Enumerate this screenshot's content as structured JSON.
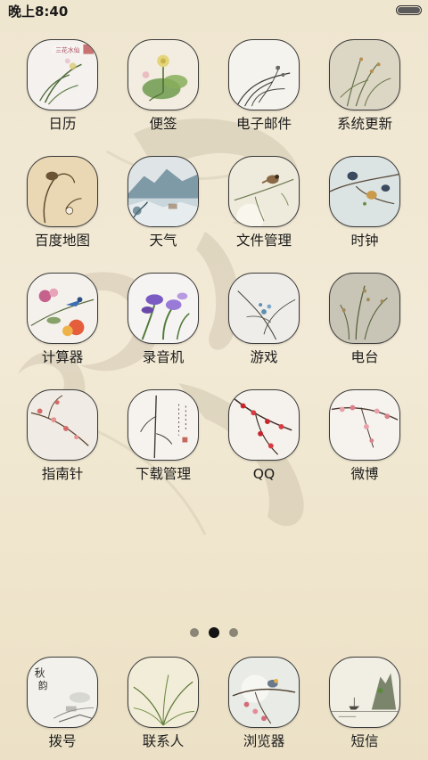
{
  "status_bar": {
    "time": "晚上8:40",
    "battery_level": 1.0
  },
  "page_indicator": {
    "page_count": 3,
    "active_page": 2
  },
  "apps": [
    [
      {
        "label": "日历",
        "icon": "orchid-calendar-icon"
      },
      {
        "label": "便签",
        "icon": "lotus-notes-icon"
      },
      {
        "label": "电子邮件",
        "icon": "orchid-email-icon"
      },
      {
        "label": "系统更新",
        "icon": "grass-update-icon"
      }
    ],
    [
      {
        "label": "百度地图",
        "icon": "lotus-pod-map-icon"
      },
      {
        "label": "天气",
        "icon": "landscape-weather-icon"
      },
      {
        "label": "文件管理",
        "icon": "sparrow-files-icon"
      },
      {
        "label": "时钟",
        "icon": "birds-clock-icon"
      }
    ],
    [
      {
        "label": "计算器",
        "icon": "bird-flower-calculator-icon"
      },
      {
        "label": "录音机",
        "icon": "iris-recorder-icon"
      },
      {
        "label": "游戏",
        "icon": "orchid-game-icon"
      },
      {
        "label": "电台",
        "icon": "grass-radio-icon"
      }
    ],
    [
      {
        "label": "指南针",
        "icon": "blossom-compass-icon"
      },
      {
        "label": "下载管理",
        "icon": "bamboo-download-icon"
      },
      {
        "label": "QQ",
        "icon": "plum-qq-icon"
      },
      {
        "label": "微博",
        "icon": "cherry-weibo-icon"
      }
    ]
  ],
  "dock": [
    {
      "label": "拨号",
      "icon": "calligraphy-phone-icon"
    },
    {
      "label": "联系人",
      "icon": "grass-contacts-icon"
    },
    {
      "label": "浏览器",
      "icon": "moon-bird-browser-icon"
    },
    {
      "label": "短信",
      "icon": "mountain-message-icon"
    }
  ],
  "colors": {
    "background": "#f0e7d1",
    "icon_border": "#3a3a3a",
    "label_text": "#1b1b1b",
    "dot_active": "#141414",
    "dot_inactive": "#8a8576"
  }
}
